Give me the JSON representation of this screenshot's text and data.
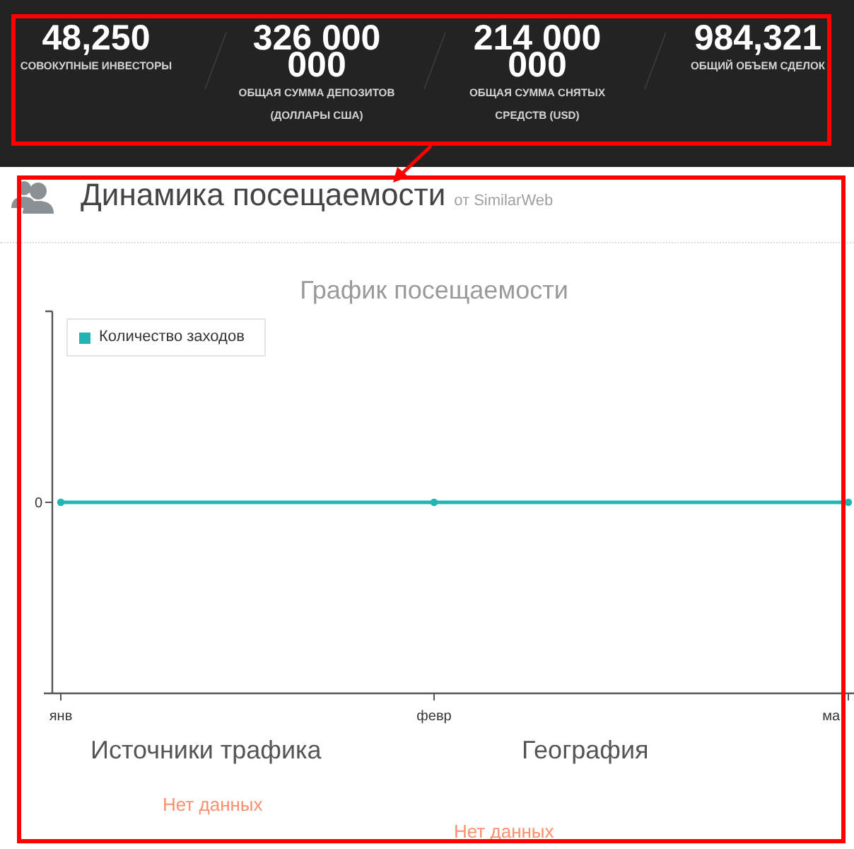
{
  "stats": [
    {
      "value": "48,250",
      "label": "СОВОКУПНЫЕ ИНВЕСТОРЫ"
    },
    {
      "value": "326 000 000",
      "label": "ОБЩАЯ СУММА ДЕПОЗИТОВ (ДОЛЛАРЫ США)"
    },
    {
      "value": "214 000 000",
      "label": "ОБЩАЯ СУММА СНЯТЫХ СРЕДСТВ (USD)"
    },
    {
      "value": "984,321",
      "label": "ОБЩИЙ ОБЪЕМ СДЕЛОК"
    }
  ],
  "traffic_section": {
    "title": "Динамика посещаемости",
    "source": "от SimilarWeb",
    "chart": {
      "title": "График посещаемости",
      "legend": [
        "Количество заходов"
      ],
      "y_axis_labels": [
        "0"
      ],
      "x_axis_labels": [
        "янв",
        "февр",
        "ма"
      ]
    }
  },
  "panels": [
    {
      "title": "Источники трафика",
      "message": "Нет данных"
    },
    {
      "title": "География",
      "message": "Нет данных"
    }
  ]
}
